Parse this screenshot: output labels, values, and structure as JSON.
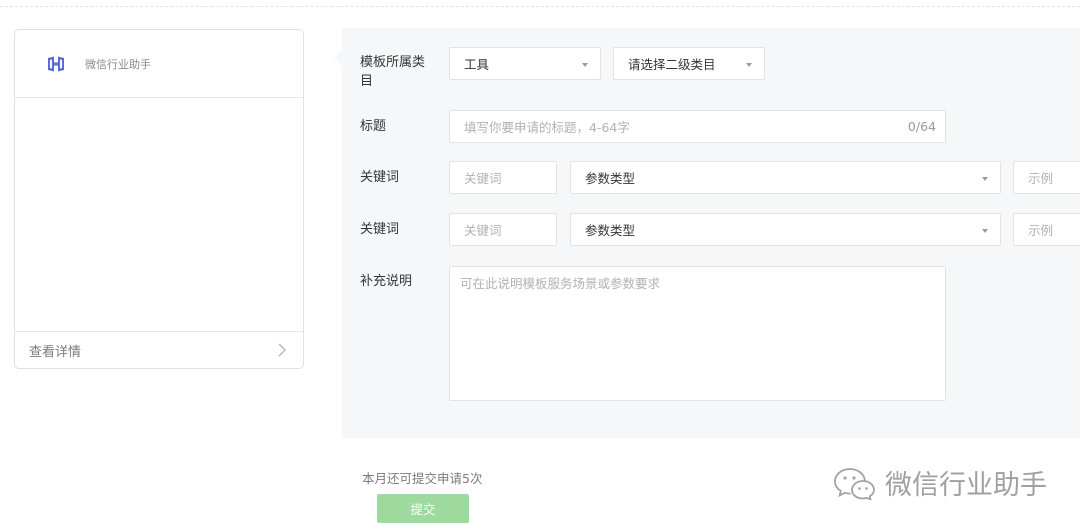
{
  "preview": {
    "account_name": "微信行业助手",
    "detail_label": "查看详情"
  },
  "form": {
    "category": {
      "label": "模板所属类目",
      "primary_value": "工具",
      "secondary_placeholder": "请选择二级类目"
    },
    "title": {
      "label": "标题",
      "placeholder": "填写你要申请的标题，4-64字",
      "counter": "0/64"
    },
    "keywords": [
      {
        "label": "关键词",
        "keyword_placeholder": "关键词",
        "param_type": "参数类型",
        "example_placeholder": "示例"
      },
      {
        "label": "关键词",
        "keyword_placeholder": "关键词",
        "param_type": "参数类型",
        "example_placeholder": "示例"
      }
    ],
    "notes": {
      "label": "补充说明",
      "placeholder": "可在此说明模板服务场景或参数要求"
    }
  },
  "footer": {
    "quota_text": "本月还可提交申请5次",
    "submit_label": "提交"
  },
  "watermark": {
    "text": "微信行业助手"
  },
  "colors": {
    "brand_icon": "#5b6bd8",
    "submit_disabled": "#9ed99d",
    "panel_bg": "#f6f7f9"
  }
}
